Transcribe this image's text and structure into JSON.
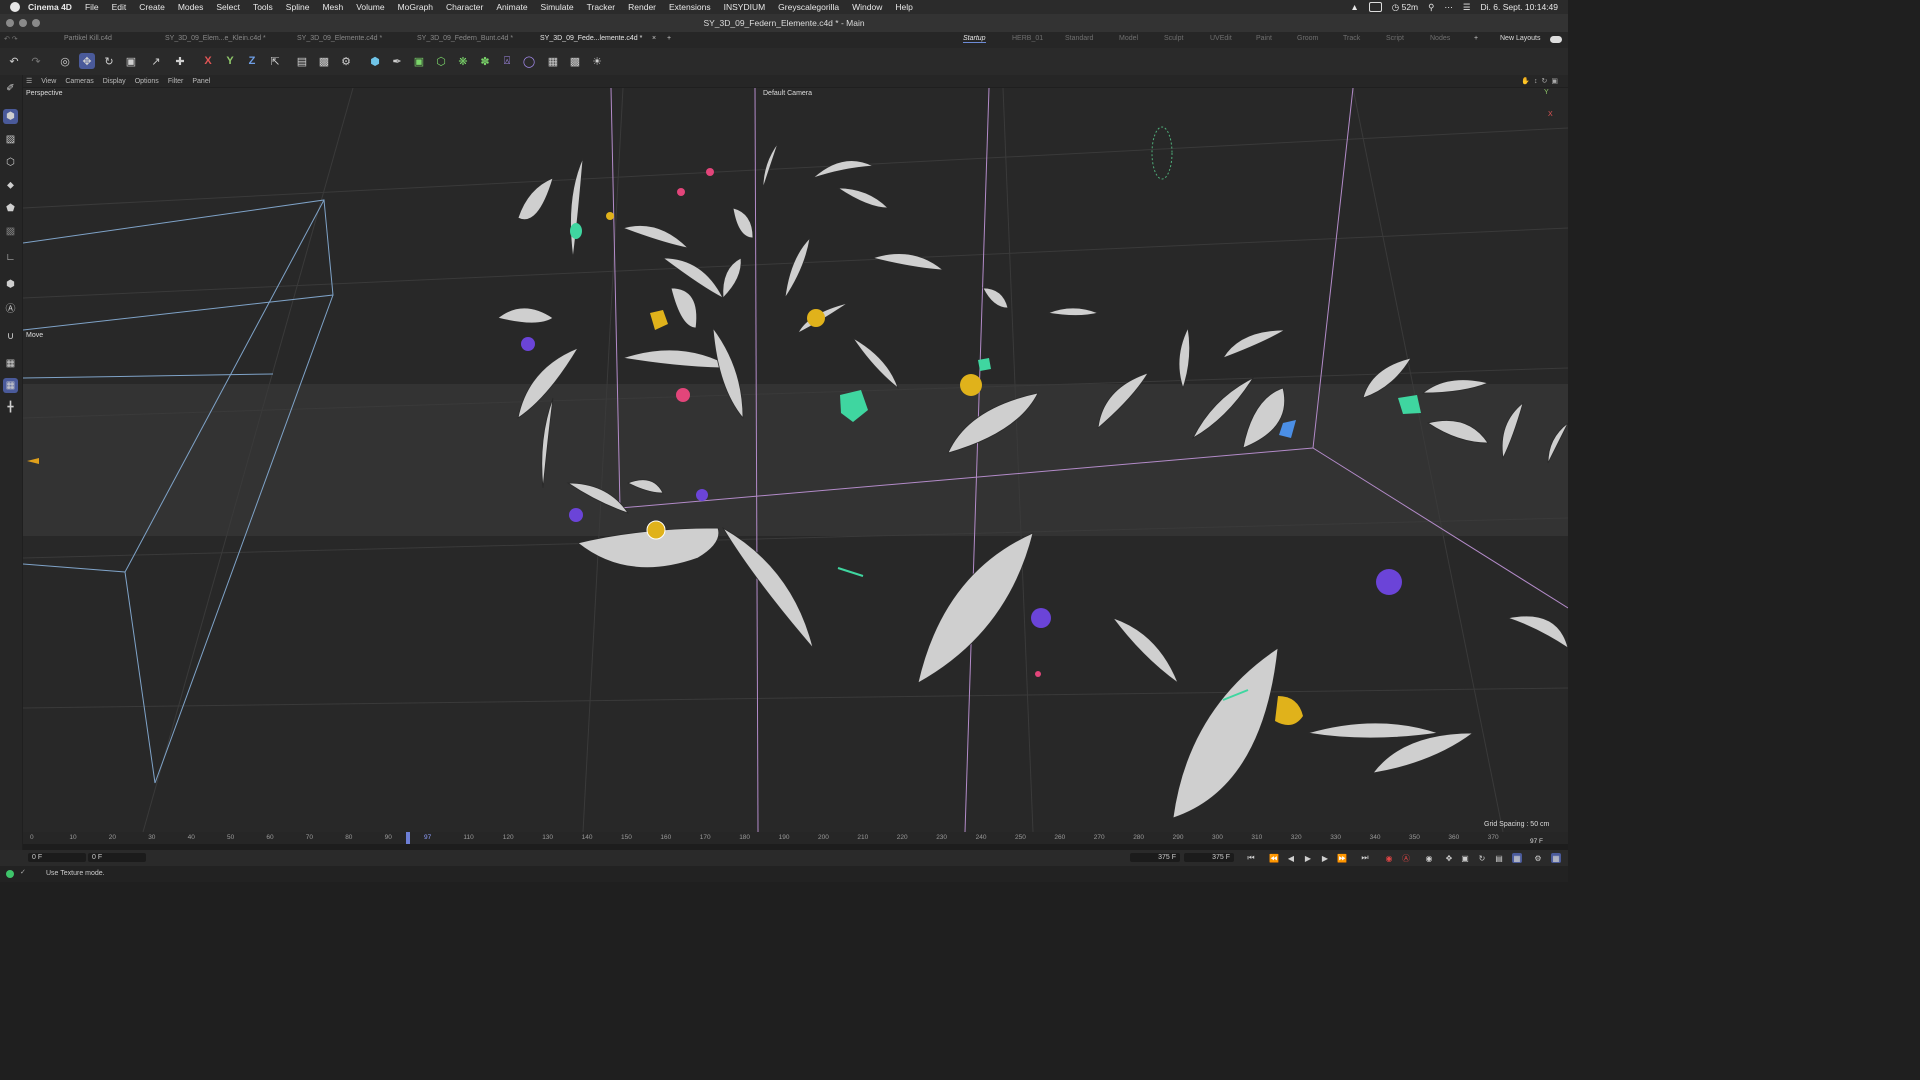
{
  "menubar": {
    "app": "Cinema 4D",
    "items": [
      "File",
      "Edit",
      "Create",
      "Modes",
      "Select",
      "Tools",
      "Spline",
      "Mesh",
      "Volume",
      "MoGraph",
      "Character",
      "Animate",
      "Simulate",
      "Tracker",
      "Render",
      "Extensions",
      "INSYDIUM",
      "Greyscalegorilla",
      "Window",
      "Help"
    ],
    "timer": "52m",
    "datetime": "Di. 6. Sept.  10:14:49"
  },
  "window": {
    "title": "SY_3D_09_Federn_Elemente.c4d * - Main"
  },
  "doc_tabs": [
    "Partikel Kill.c4d",
    "SY_3D_09_Elem...e_Klein.c4d *",
    "SY_3D_09_Elemente.c4d *",
    "SY_3D_09_Federn_Bunt.c4d *",
    "SY_3D_09_Fede...lemente.c4d *"
  ],
  "layout_tabs": [
    "Startup",
    "HERB_01",
    "Standard",
    "Model",
    "Sculpt",
    "UVEdit",
    "Paint",
    "Groom",
    "Track",
    "Script",
    "Nodes"
  ],
  "new_layouts": "New Layouts",
  "toolbar": {
    "undo": "undo-icon",
    "redo": "redo-icon",
    "axis_x": "X",
    "axis_y": "Y",
    "axis_z": "Z"
  },
  "viewport_menu": [
    "View",
    "Cameras",
    "Display",
    "Options",
    "Filter",
    "Panel"
  ],
  "viewport": {
    "label": "Perspective",
    "camera": "Default Camera",
    "tool_label": "Move",
    "grid_spacing": "Grid Spacing : 50 cm",
    "axis_y": "Y",
    "axis_x": "X"
  },
  "timeline": {
    "ticks": [
      "0",
      "10",
      "20",
      "30",
      "40",
      "50",
      "60",
      "70",
      "80",
      "90",
      "97",
      "110",
      "120",
      "130",
      "140",
      "150",
      "160",
      "170",
      "180",
      "190",
      "200",
      "210",
      "220",
      "230",
      "240",
      "250",
      "260",
      "270",
      "280",
      "290",
      "300",
      "310",
      "320",
      "330",
      "340",
      "350",
      "360",
      "370"
    ],
    "current_frame": "97 F",
    "playhead_value": 97
  },
  "transport": {
    "start": "0 F",
    "min": "0 F",
    "max": "375 F",
    "end": "375 F"
  },
  "status": {
    "message": "Use Texture mode."
  }
}
